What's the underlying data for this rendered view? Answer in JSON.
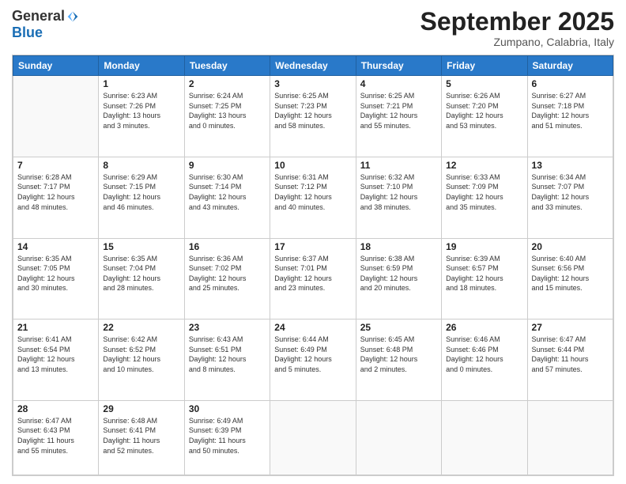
{
  "logo": {
    "general": "General",
    "blue": "Blue"
  },
  "title": "September 2025",
  "subtitle": "Zumpano, Calabria, Italy",
  "headers": [
    "Sunday",
    "Monday",
    "Tuesday",
    "Wednesday",
    "Thursday",
    "Friday",
    "Saturday"
  ],
  "weeks": [
    [
      {
        "day": "",
        "info": ""
      },
      {
        "day": "1",
        "info": "Sunrise: 6:23 AM\nSunset: 7:26 PM\nDaylight: 13 hours\nand 3 minutes."
      },
      {
        "day": "2",
        "info": "Sunrise: 6:24 AM\nSunset: 7:25 PM\nDaylight: 13 hours\nand 0 minutes."
      },
      {
        "day": "3",
        "info": "Sunrise: 6:25 AM\nSunset: 7:23 PM\nDaylight: 12 hours\nand 58 minutes."
      },
      {
        "day": "4",
        "info": "Sunrise: 6:25 AM\nSunset: 7:21 PM\nDaylight: 12 hours\nand 55 minutes."
      },
      {
        "day": "5",
        "info": "Sunrise: 6:26 AM\nSunset: 7:20 PM\nDaylight: 12 hours\nand 53 minutes."
      },
      {
        "day": "6",
        "info": "Sunrise: 6:27 AM\nSunset: 7:18 PM\nDaylight: 12 hours\nand 51 minutes."
      }
    ],
    [
      {
        "day": "7",
        "info": "Sunrise: 6:28 AM\nSunset: 7:17 PM\nDaylight: 12 hours\nand 48 minutes."
      },
      {
        "day": "8",
        "info": "Sunrise: 6:29 AM\nSunset: 7:15 PM\nDaylight: 12 hours\nand 46 minutes."
      },
      {
        "day": "9",
        "info": "Sunrise: 6:30 AM\nSunset: 7:14 PM\nDaylight: 12 hours\nand 43 minutes."
      },
      {
        "day": "10",
        "info": "Sunrise: 6:31 AM\nSunset: 7:12 PM\nDaylight: 12 hours\nand 40 minutes."
      },
      {
        "day": "11",
        "info": "Sunrise: 6:32 AM\nSunset: 7:10 PM\nDaylight: 12 hours\nand 38 minutes."
      },
      {
        "day": "12",
        "info": "Sunrise: 6:33 AM\nSunset: 7:09 PM\nDaylight: 12 hours\nand 35 minutes."
      },
      {
        "day": "13",
        "info": "Sunrise: 6:34 AM\nSunset: 7:07 PM\nDaylight: 12 hours\nand 33 minutes."
      }
    ],
    [
      {
        "day": "14",
        "info": "Sunrise: 6:35 AM\nSunset: 7:05 PM\nDaylight: 12 hours\nand 30 minutes."
      },
      {
        "day": "15",
        "info": "Sunrise: 6:35 AM\nSunset: 7:04 PM\nDaylight: 12 hours\nand 28 minutes."
      },
      {
        "day": "16",
        "info": "Sunrise: 6:36 AM\nSunset: 7:02 PM\nDaylight: 12 hours\nand 25 minutes."
      },
      {
        "day": "17",
        "info": "Sunrise: 6:37 AM\nSunset: 7:01 PM\nDaylight: 12 hours\nand 23 minutes."
      },
      {
        "day": "18",
        "info": "Sunrise: 6:38 AM\nSunset: 6:59 PM\nDaylight: 12 hours\nand 20 minutes."
      },
      {
        "day": "19",
        "info": "Sunrise: 6:39 AM\nSunset: 6:57 PM\nDaylight: 12 hours\nand 18 minutes."
      },
      {
        "day": "20",
        "info": "Sunrise: 6:40 AM\nSunset: 6:56 PM\nDaylight: 12 hours\nand 15 minutes."
      }
    ],
    [
      {
        "day": "21",
        "info": "Sunrise: 6:41 AM\nSunset: 6:54 PM\nDaylight: 12 hours\nand 13 minutes."
      },
      {
        "day": "22",
        "info": "Sunrise: 6:42 AM\nSunset: 6:52 PM\nDaylight: 12 hours\nand 10 minutes."
      },
      {
        "day": "23",
        "info": "Sunrise: 6:43 AM\nSunset: 6:51 PM\nDaylight: 12 hours\nand 8 minutes."
      },
      {
        "day": "24",
        "info": "Sunrise: 6:44 AM\nSunset: 6:49 PM\nDaylight: 12 hours\nand 5 minutes."
      },
      {
        "day": "25",
        "info": "Sunrise: 6:45 AM\nSunset: 6:48 PM\nDaylight: 12 hours\nand 2 minutes."
      },
      {
        "day": "26",
        "info": "Sunrise: 6:46 AM\nSunset: 6:46 PM\nDaylight: 12 hours\nand 0 minutes."
      },
      {
        "day": "27",
        "info": "Sunrise: 6:47 AM\nSunset: 6:44 PM\nDaylight: 11 hours\nand 57 minutes."
      }
    ],
    [
      {
        "day": "28",
        "info": "Sunrise: 6:47 AM\nSunset: 6:43 PM\nDaylight: 11 hours\nand 55 minutes."
      },
      {
        "day": "29",
        "info": "Sunrise: 6:48 AM\nSunset: 6:41 PM\nDaylight: 11 hours\nand 52 minutes."
      },
      {
        "day": "30",
        "info": "Sunrise: 6:49 AM\nSunset: 6:39 PM\nDaylight: 11 hours\nand 50 minutes."
      },
      {
        "day": "",
        "info": ""
      },
      {
        "day": "",
        "info": ""
      },
      {
        "day": "",
        "info": ""
      },
      {
        "day": "",
        "info": ""
      }
    ]
  ]
}
